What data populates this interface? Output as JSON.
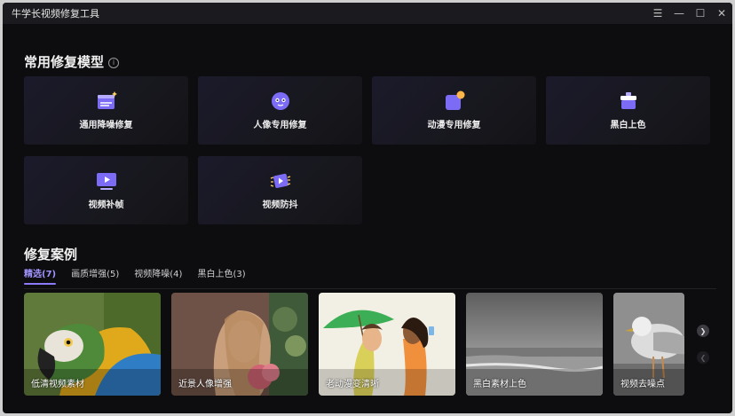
{
  "window": {
    "title": "牛学长视频修复工具"
  },
  "models": {
    "title": "常用修复模型",
    "items": [
      {
        "label": "通用降噪修复",
        "icon": "clapperboard-icon"
      },
      {
        "label": "人像专用修复",
        "icon": "face-icon"
      },
      {
        "label": "动漫专用修复",
        "icon": "anime-icon"
      },
      {
        "label": "黑白上色",
        "icon": "paint-bucket-icon"
      },
      {
        "label": "视频补帧",
        "icon": "video-play-icon"
      },
      {
        "label": "视频防抖",
        "icon": "stabilize-icon"
      }
    ]
  },
  "cases": {
    "title": "修复案例",
    "tabs": [
      {
        "label": "精选(7)",
        "active": true
      },
      {
        "label": "画质增强(5)",
        "active": false
      },
      {
        "label": "视频降噪(4)",
        "active": false
      },
      {
        "label": "黑白上色(3)",
        "active": false
      }
    ],
    "items": [
      {
        "caption": "低清视频素材"
      },
      {
        "caption": "近景人像增强"
      },
      {
        "caption": "老动漫变清晰"
      },
      {
        "caption": "黑白素材上色"
      },
      {
        "caption": "视频去噪点"
      }
    ]
  },
  "colors": {
    "accent": "#8b7bff",
    "background": "#0d0d10",
    "card": "#1b1a2b"
  }
}
